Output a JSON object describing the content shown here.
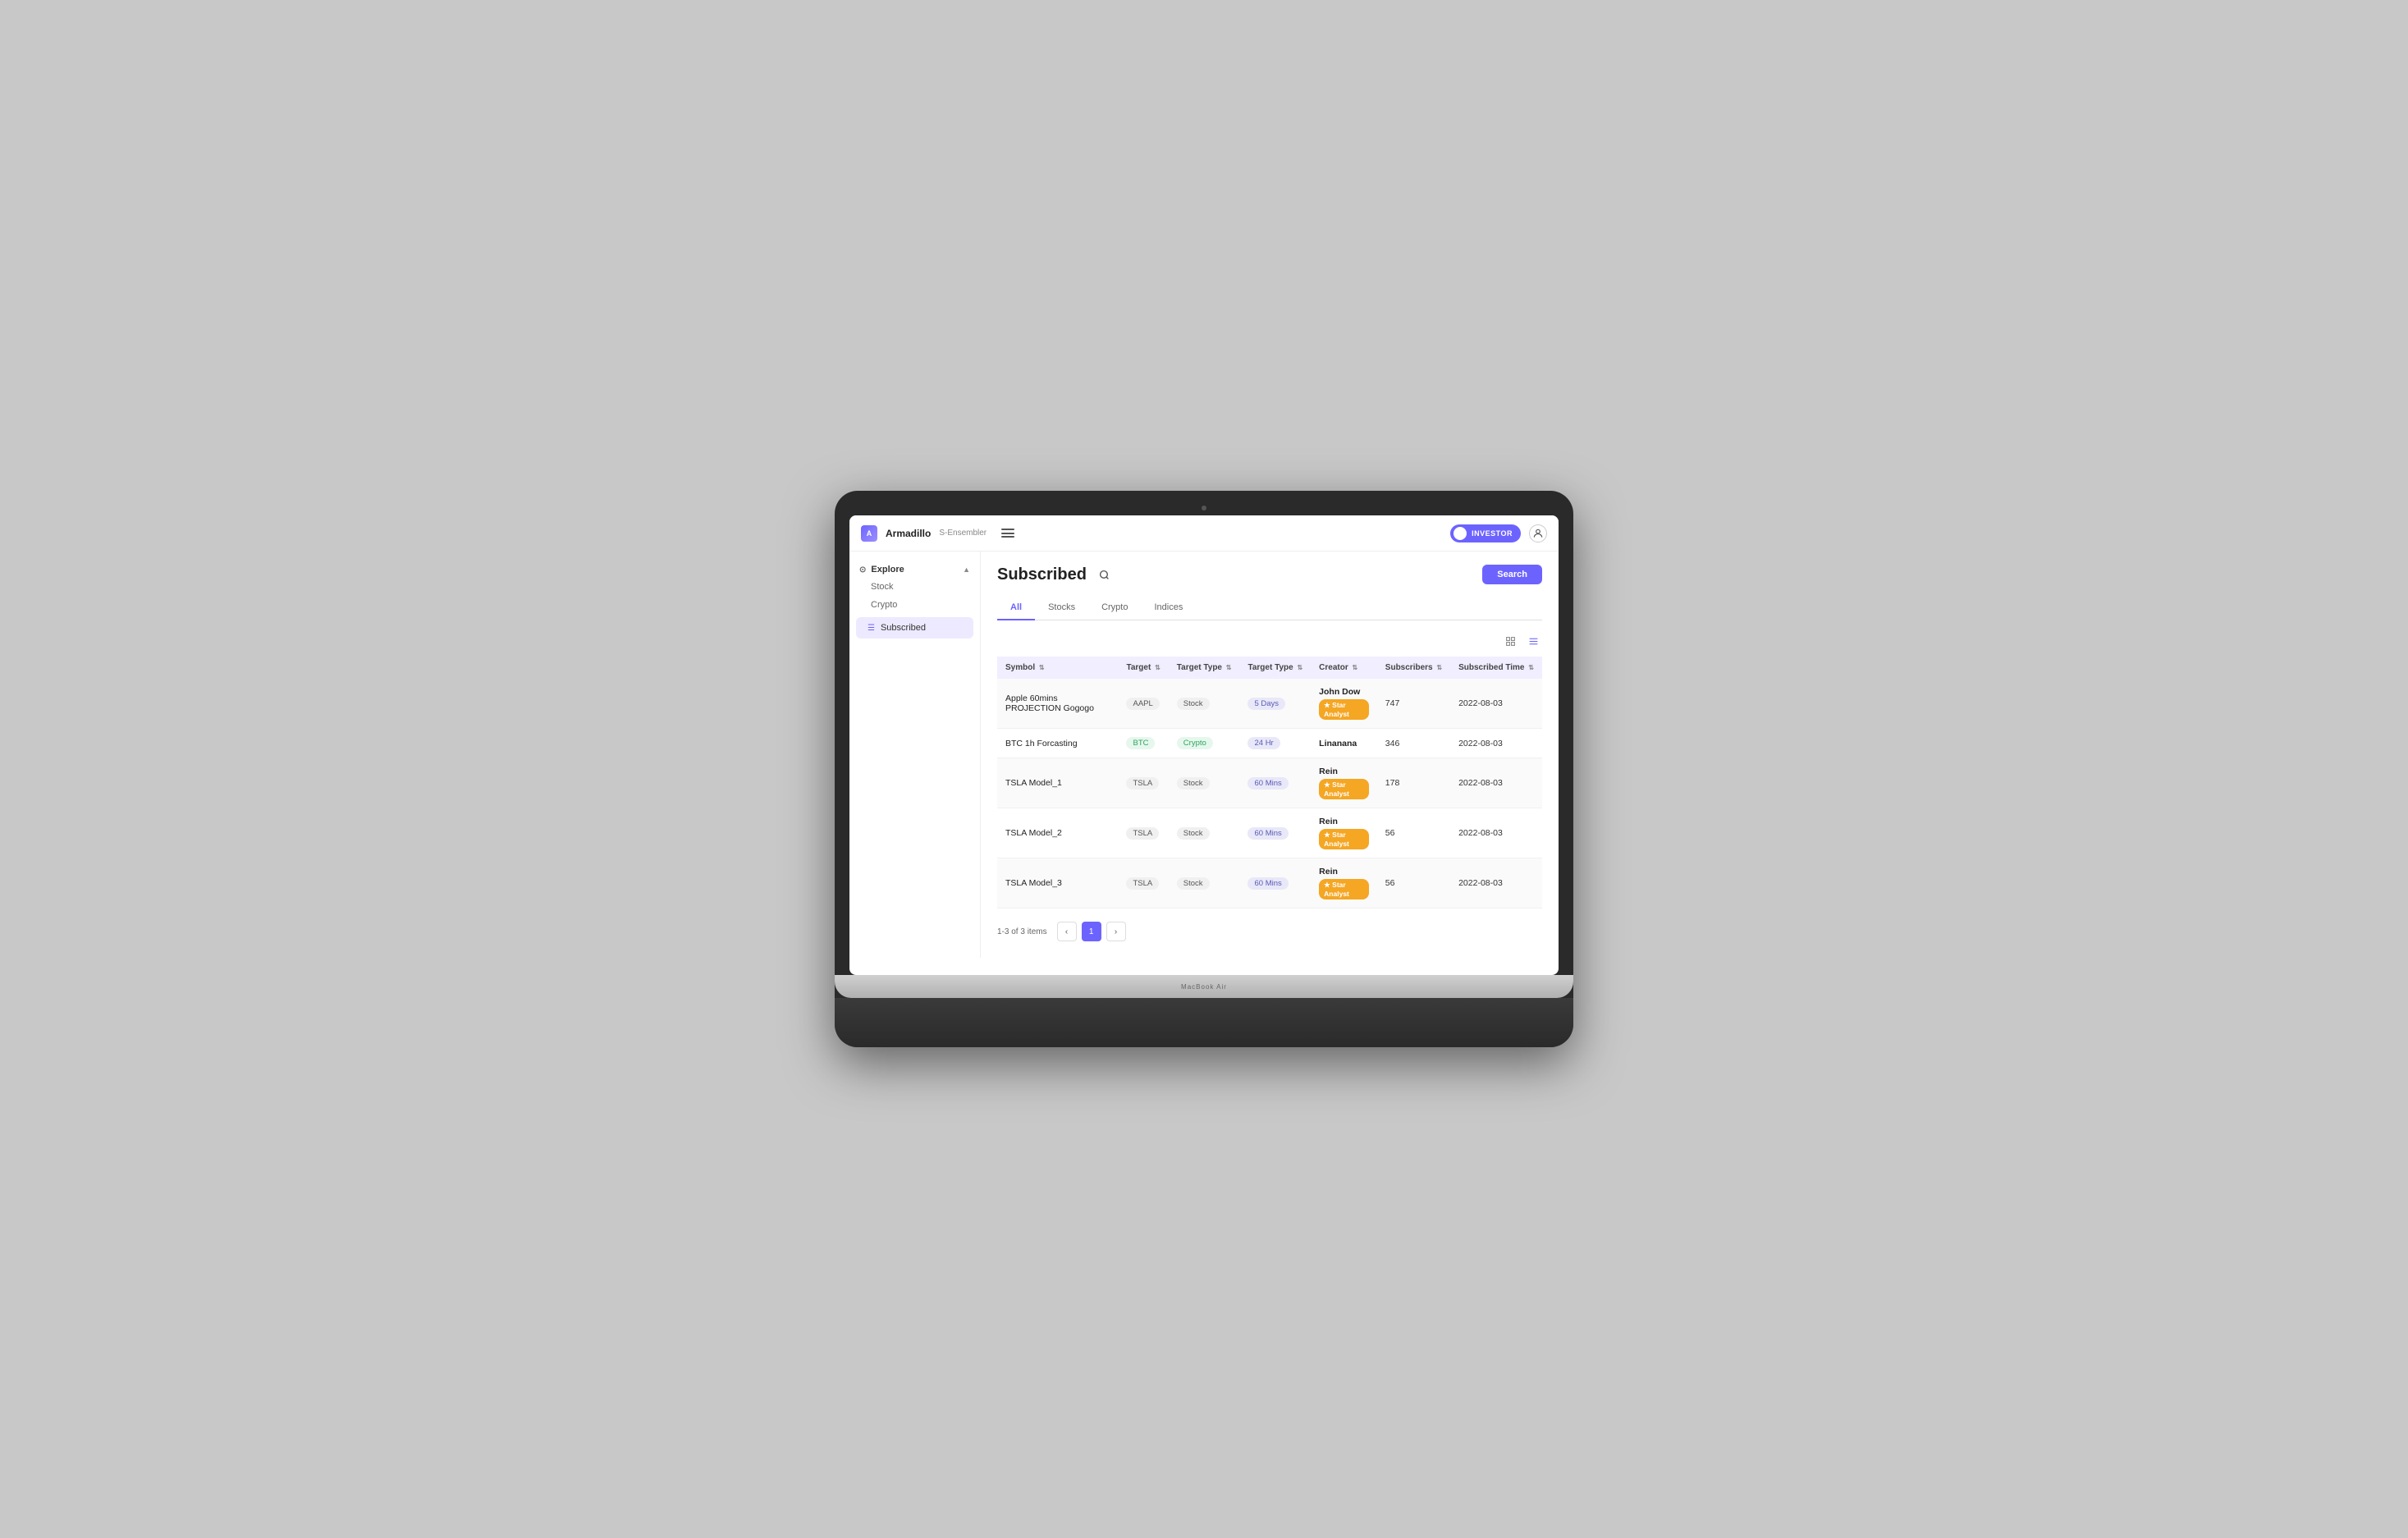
{
  "topbar": {
    "logo_letter": "A",
    "app_name": "Armadillo",
    "app_subtitle": "S-Ensembler",
    "investor_label": "INVESTOR",
    "user_icon": "👤"
  },
  "sidebar": {
    "explore_label": "Explore",
    "sub_items": [
      {
        "label": "Stock",
        "id": "stock"
      },
      {
        "label": "Crypto",
        "id": "crypto"
      }
    ],
    "nav_items": [
      {
        "label": "Subscribed",
        "id": "subscribed",
        "active": true
      }
    ]
  },
  "page": {
    "title": "Subscribed",
    "search_button": "Search",
    "tabs": [
      {
        "label": "All",
        "active": true
      },
      {
        "label": "Stocks",
        "active": false
      },
      {
        "label": "Crypto",
        "active": false
      },
      {
        "label": "Indices",
        "active": false
      }
    ]
  },
  "table": {
    "columns": [
      {
        "label": "Symbol",
        "key": "symbol"
      },
      {
        "label": "Target",
        "key": "target"
      },
      {
        "label": "Target Type",
        "key": "target_type"
      },
      {
        "label": "Target Type",
        "key": "target_type2"
      },
      {
        "label": "Creator",
        "key": "creator"
      },
      {
        "label": "Subscribers",
        "key": "subscribers"
      },
      {
        "label": "Subscribed Time",
        "key": "subscribed_time"
      }
    ],
    "rows": [
      {
        "name": "Apple 60mins PROJECTION Gogogo",
        "symbol": "AAPL",
        "symbol_type": "stock",
        "target_type": "Stock",
        "target_type2": "5 Days",
        "target_type2_class": "badge-5days",
        "creator_name": "John Dow",
        "creator_badge": "★ Star Analyst",
        "subscribers": "747",
        "subscribed_time": "2022-08-03",
        "has_badge": true
      },
      {
        "name": "BTC 1h Forcasting",
        "symbol": "BTC",
        "symbol_type": "crypto",
        "target_type": "Crypto",
        "target_type2": "24 Hr",
        "target_type2_class": "badge-24hr",
        "creator_name": "Linanana",
        "creator_badge": "",
        "subscribers": "346",
        "subscribed_time": "2022-08-03",
        "has_badge": false
      },
      {
        "name": "TSLA Model_1",
        "symbol": "TSLA",
        "symbol_type": "stock",
        "target_type": "Stock",
        "target_type2": "60 Mins",
        "target_type2_class": "badge-60mins",
        "creator_name": "Rein",
        "creator_badge": "★ Star Analyst",
        "subscribers": "178",
        "subscribed_time": "2022-08-03",
        "has_badge": true
      },
      {
        "name": "TSLA Model_2",
        "symbol": "TSLA",
        "symbol_type": "stock",
        "target_type": "Stock",
        "target_type2": "60 Mins",
        "target_type2_class": "badge-60mins",
        "creator_name": "Rein",
        "creator_badge": "★ Star Analyst",
        "subscribers": "56",
        "subscribed_time": "2022-08-03",
        "has_badge": true
      },
      {
        "name": "TSLA Model_3",
        "symbol": "TSLA",
        "symbol_type": "stock",
        "target_type": "Stock",
        "target_type2": "60 Mins",
        "target_type2_class": "badge-60mins",
        "creator_name": "Rein",
        "creator_badge": "★ Star Analyst",
        "subscribers": "56",
        "subscribed_time": "2022-08-03",
        "has_badge": true
      }
    ]
  },
  "pagination": {
    "info": "1-3 of 3 items",
    "current_page": 1
  },
  "macbook_label": "MacBook Air"
}
